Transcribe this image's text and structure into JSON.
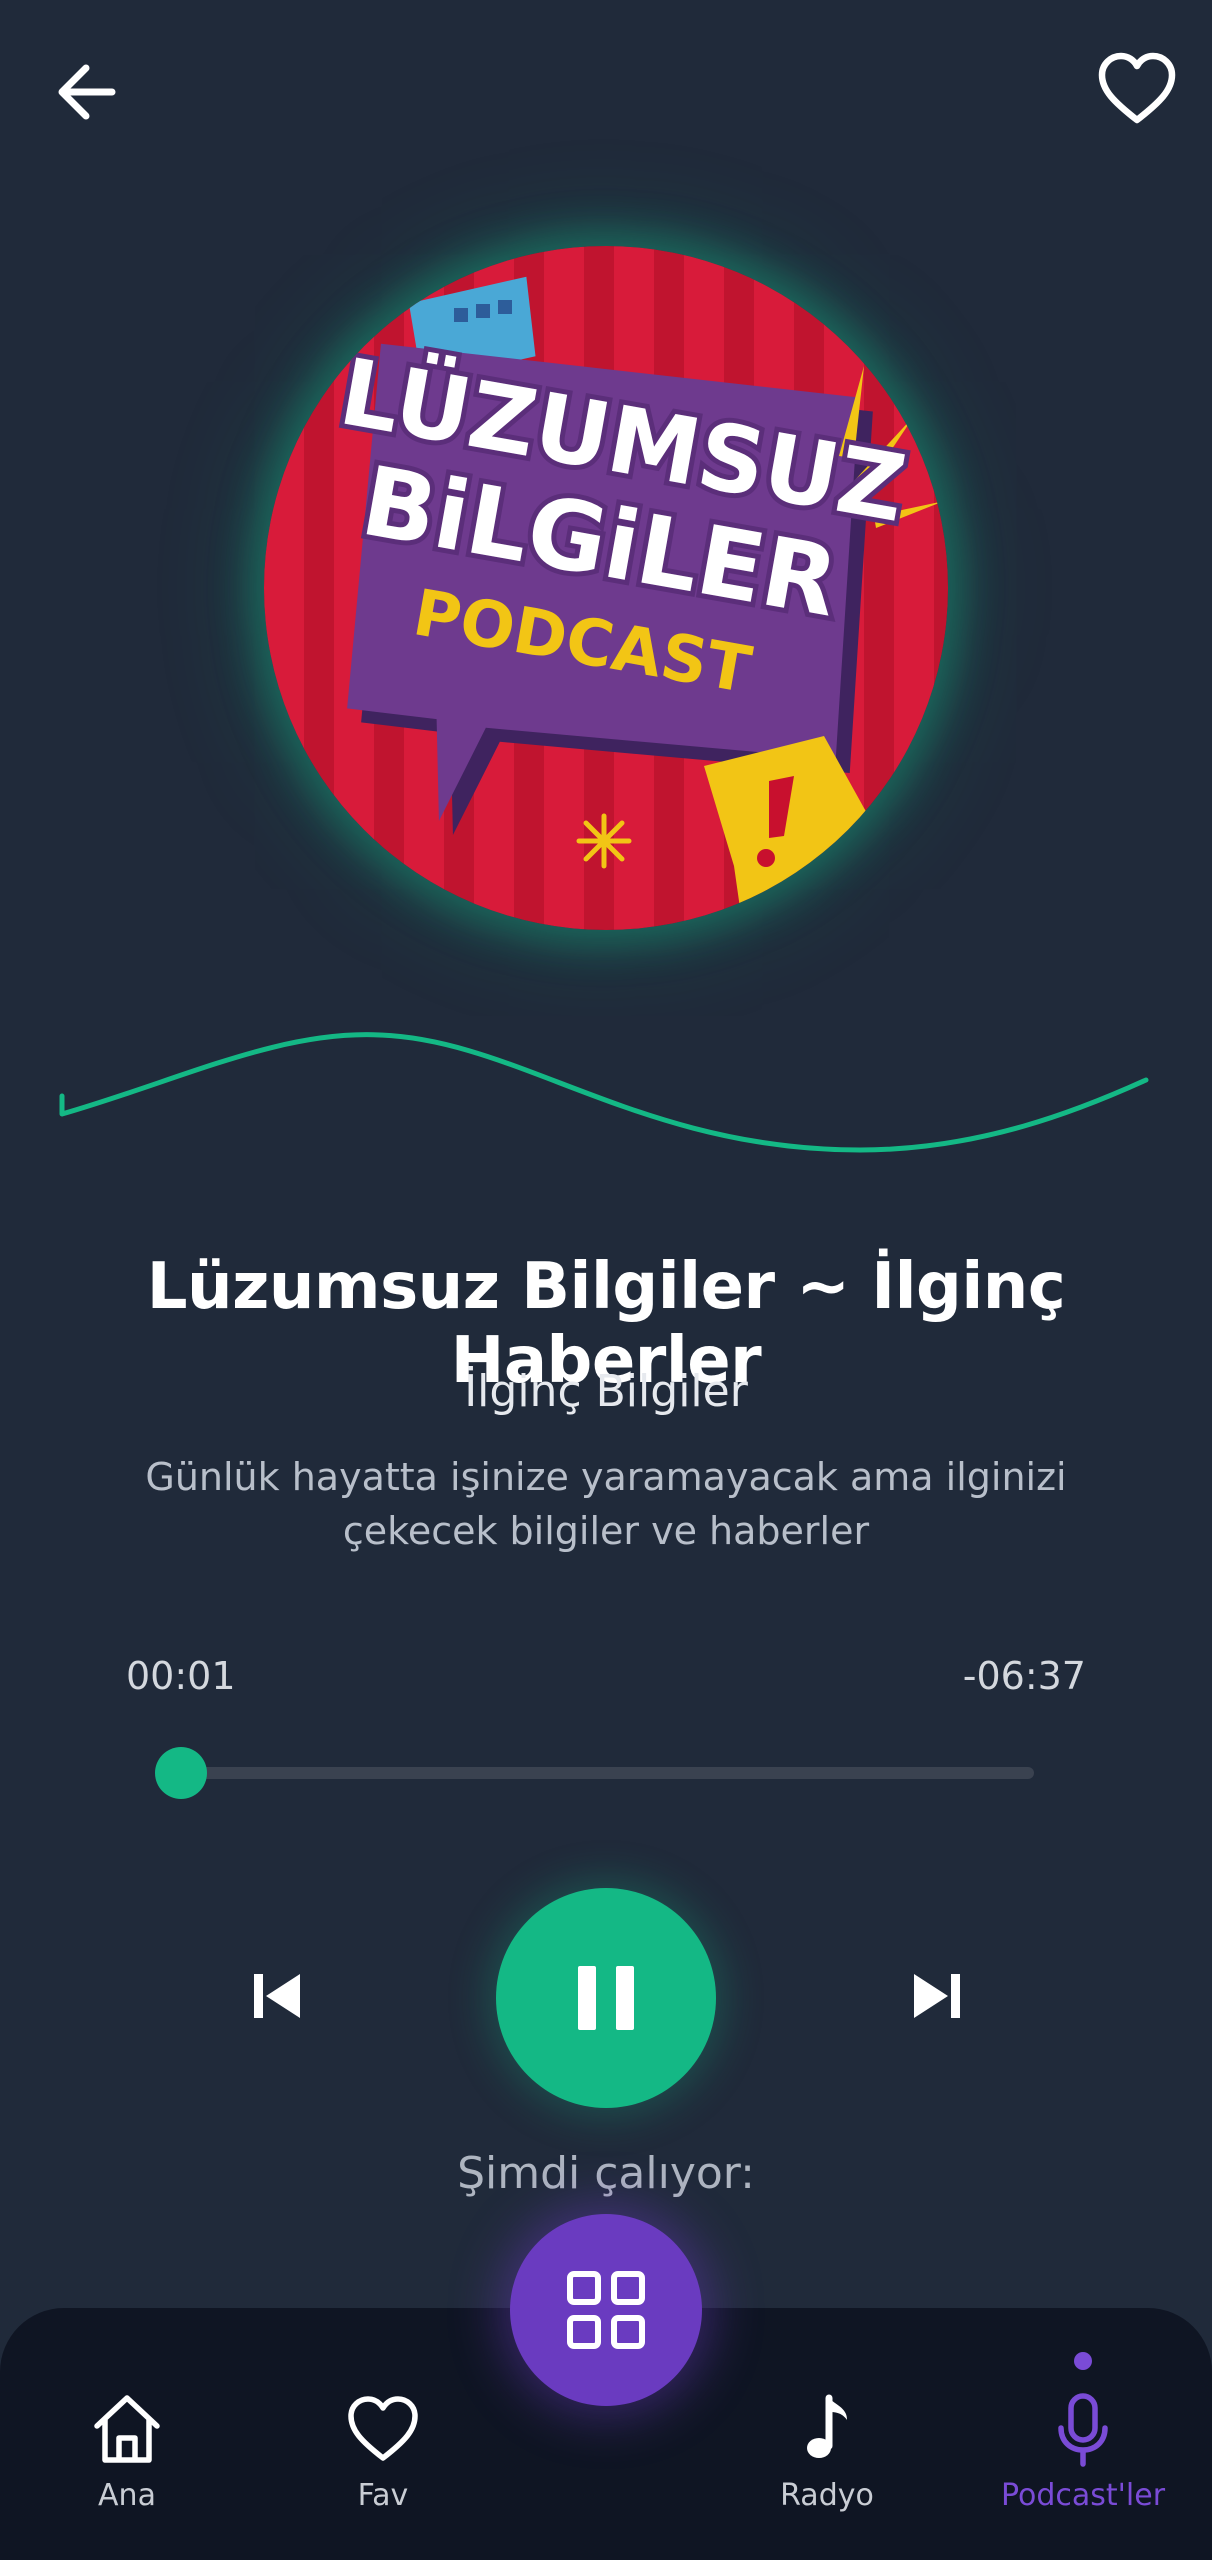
{
  "header": {
    "back_icon": "arrow-left-icon",
    "favorite_icon": "heart-outline-icon"
  },
  "cover": {
    "line1": "LÜZUMSUZ",
    "line2": "BiLGiLER",
    "line3": "PODCAST"
  },
  "episode": {
    "title": "Lüzumsuz Bilgiler ~ İlginç Haberler",
    "subtitle": "İlginç Bilgiler",
    "description": "Günlük hayatta işinize yaramayacak ama ilginizi çekecek bilgiler ve haberler"
  },
  "player": {
    "elapsed": "00:01",
    "remaining": "-06:37",
    "progress_fraction": 0.003,
    "state": "playing",
    "prev_icon": "skip-previous-icon",
    "next_icon": "skip-next-icon",
    "pause_icon": "pause-icon"
  },
  "now_playing_label": "Şimdi çalıyor:",
  "nav": {
    "items": [
      {
        "label": "Ana",
        "icon": "home-icon"
      },
      {
        "label": "Fav",
        "icon": "heart-icon"
      },
      {
        "label": "Radyo",
        "icon": "music-note-icon"
      },
      {
        "label": "Podcast'ler",
        "icon": "microphone-icon",
        "active": true
      }
    ],
    "center_button_icon": "grid-icon"
  },
  "colors": {
    "background": "#202a3a",
    "accent_green": "#14b885",
    "accent_purple": "#6a3bc0",
    "nav_background": "#0f1523"
  }
}
